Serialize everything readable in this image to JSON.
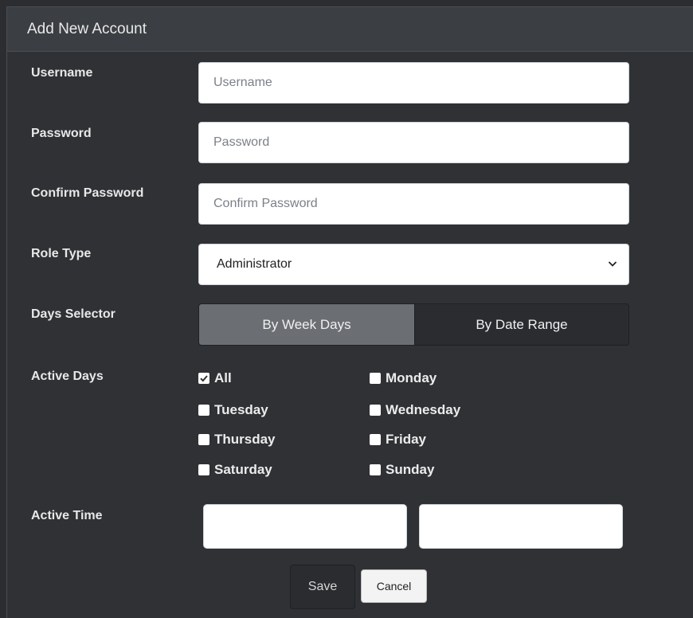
{
  "header": {
    "title": "Add New Account"
  },
  "form": {
    "username": {
      "label": "Username",
      "placeholder": "Username",
      "value": ""
    },
    "password": {
      "label": "Password",
      "placeholder": "Password",
      "value": ""
    },
    "confirm_password": {
      "label": "Confirm Password",
      "placeholder": "Confirm Password",
      "value": ""
    },
    "role_type": {
      "label": "Role Type",
      "selected": "Administrator"
    },
    "days_selector": {
      "label": "Days Selector",
      "options": [
        "By Week Days",
        "By Date Range"
      ],
      "active": "By Week Days"
    },
    "active_days": {
      "label": "Active Days",
      "days": [
        {
          "label": "All",
          "checked": true
        },
        {
          "label": "Monday",
          "checked": false
        },
        {
          "label": "Tuesday",
          "checked": false
        },
        {
          "label": "Wednesday",
          "checked": false
        },
        {
          "label": "Thursday",
          "checked": false
        },
        {
          "label": "Friday",
          "checked": false
        },
        {
          "label": "Saturday",
          "checked": false
        },
        {
          "label": "Sunday",
          "checked": false
        }
      ]
    },
    "active_time": {
      "label": "Active Time",
      "start": "",
      "end": ""
    }
  },
  "buttons": {
    "save": "Save",
    "cancel": "Cancel"
  },
  "colors": {
    "background": "#2f3134",
    "header": "#3b3e42",
    "segment_active": "#6b6f74",
    "segment_inactive": "#2a2c2f"
  }
}
